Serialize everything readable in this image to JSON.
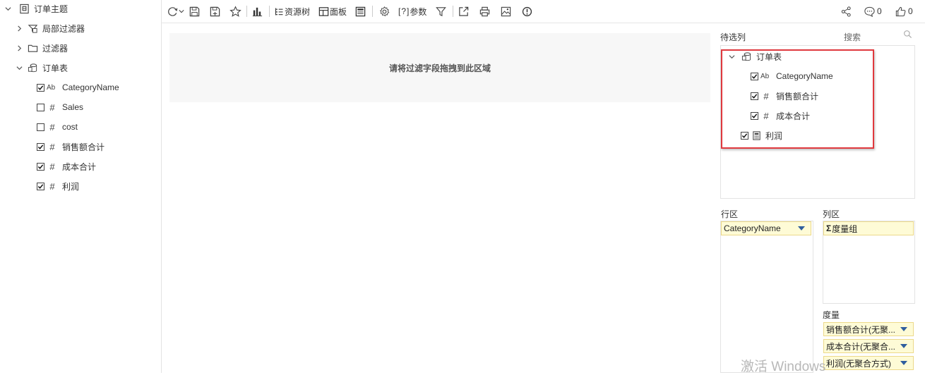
{
  "tree": {
    "root": "订单主题",
    "local_filter": "局部过滤器",
    "filter": "过滤器",
    "table": "订单表",
    "fields": [
      {
        "type": "Ab",
        "label": "CategoryName",
        "checked": true
      },
      {
        "type": "#",
        "label": "Sales",
        "checked": false
      },
      {
        "type": "#",
        "label": "cost",
        "checked": false
      },
      {
        "type": "#",
        "label": "销售额合计",
        "checked": true
      },
      {
        "type": "#",
        "label": "成本合计",
        "checked": true
      },
      {
        "type": "#",
        "label": "利润",
        "checked": true
      }
    ]
  },
  "toolbar": {
    "resource_tree": "资源树",
    "panel": "面板",
    "params_prefix": "[?]",
    "params": "参数",
    "comment_count": "0",
    "like_count": "0"
  },
  "center": {
    "dropzone_text": "请将过滤字段拖拽到此区域"
  },
  "right": {
    "candidates_label": "待选列",
    "search_placeholder": "搜索",
    "candidates": {
      "table": "订单表",
      "fields": [
        {
          "type": "Ab",
          "label": "CategoryName",
          "checked": true
        },
        {
          "type": "#",
          "label": "销售额合计",
          "checked": true
        },
        {
          "type": "#",
          "label": "成本合计",
          "checked": true
        }
      ],
      "calc_field": {
        "label": "利润",
        "checked": true
      }
    },
    "row_label": "行区",
    "col_label": "列区",
    "row_item": "CategoryName",
    "col_item": "度量组",
    "measures_label": "度量",
    "measures": [
      "销售额合计(无聚...",
      "成本合计(无聚合...",
      "利润(无聚合方式)"
    ]
  },
  "watermark": "激活 Windows",
  "colors": {
    "highlight": "#e0393e",
    "pill_bg": "#fefbd6",
    "pill_border": "#ecd98a",
    "dropdown": "#2f5e9e"
  }
}
